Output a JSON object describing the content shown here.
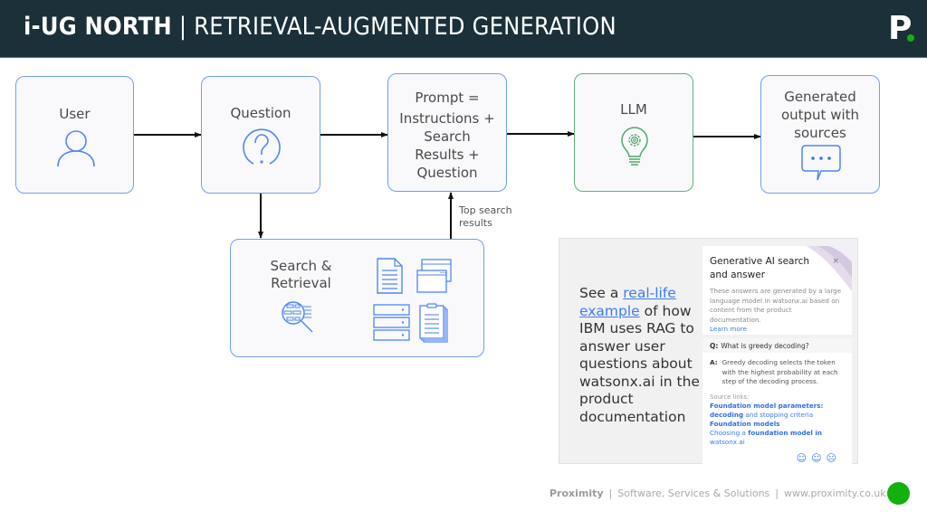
{
  "header": {
    "title_bold": "i-UG NORTH",
    "title_separator": "|",
    "title_rest": "RETRIEVAL-AUGMENTED GENERATION",
    "logo_letter": "P"
  },
  "colors": {
    "header_bg": "#1b3038",
    "node_border_blue": "#6e9ef5",
    "node_border_green": "#5fb07a",
    "icon_blue": "#4f86f7",
    "icon_green": "#4fa86a",
    "link_blue": "#3b7cf0",
    "accent_green": "#13b10e"
  },
  "diagram": {
    "nodes": {
      "user": {
        "label": "User",
        "icon": "user-icon"
      },
      "question": {
        "label": "Question",
        "icon": "question-icon"
      },
      "prompt": {
        "lines": [
          "Prompt =",
          "Instructions +",
          "Search",
          "Results +",
          "Question"
        ]
      },
      "llm": {
        "label": "LLM",
        "icon": "lightbulb-gear-icon"
      },
      "output": {
        "lines": [
          "Generated",
          "output with",
          "sources"
        ],
        "icon": "chat-bubble-icon"
      },
      "search": {
        "lines": [
          "Search &",
          "Retrieval"
        ],
        "icons": [
          "magnifier-data-icon",
          "document-icon",
          "browser-windows-icon",
          "server-stack-icon",
          "clipboard-stack-icon"
        ]
      }
    },
    "edges": [
      {
        "from": "user",
        "to": "question"
      },
      {
        "from": "question",
        "to": "prompt"
      },
      {
        "from": "prompt",
        "to": "llm"
      },
      {
        "from": "llm",
        "to": "output"
      },
      {
        "from": "question",
        "to": "search"
      },
      {
        "from": "search",
        "to": "prompt",
        "label": [
          "Top search",
          "results"
        ]
      }
    ]
  },
  "example": {
    "text_before": "See a ",
    "link_text": "real-life example",
    "text_after": " of how IBM uses RAG to answer user questions about watsonx.ai in the product documentation",
    "card": {
      "title": "Generative AI search and answer",
      "close": "×",
      "description": "These answers are generated by a large language model in watsonx.ai based on content from the product documentation.",
      "learn_more": "Learn more",
      "q_label": "Q:",
      "question": "What is greedy decoding?",
      "a_label": "A:",
      "answer": "Greedy decoding selects the token with the highest probability at each step of the decoding process.",
      "source_links_label": "Source links:",
      "links": [
        {
          "bold": "Foundation model parameters: decoding",
          "plain": " and stopping criteria"
        },
        {
          "bold": "Foundation models",
          "plain": ""
        },
        {
          "pre": "Choosing a ",
          "bold": "foundation model in",
          "plain": " watsonx.ai"
        }
      ],
      "feedback": [
        "☺",
        "☺",
        "☹"
      ]
    }
  },
  "footer": {
    "company": "Proximity",
    "tagline": "Software, Services & Solutions",
    "url": "www.proximity.co.uk",
    "sep": "|"
  }
}
